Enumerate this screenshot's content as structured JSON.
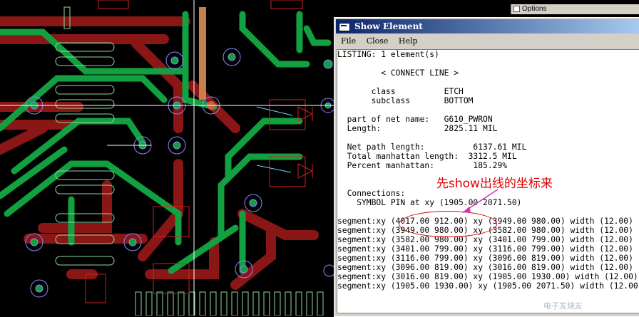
{
  "colors": {
    "green": "#13a040",
    "red": "#8b1616",
    "pad": "#8fd9a0",
    "via_ring": "#8888ff",
    "bg": "#000000",
    "annotation": "#e00000"
  },
  "options_bar": {
    "label": "Options"
  },
  "window": {
    "title": "Show Element",
    "menu": [
      "File",
      "Close",
      "Help"
    ],
    "listing": [
      "LISTING: 1 element(s)",
      "",
      "         < CONNECT LINE >",
      "",
      "       class          ETCH",
      "       subclass       BOTTOM",
      "",
      "  part of net name:   G610_PWRON",
      "  Length:             2825.11 MIL",
      "",
      "  Net path length:          6137.61 MIL",
      "  Total manhattan length:  3312.5 MIL",
      "  Percent manhattan:        185.29%",
      "",
      "",
      "  Connections:",
      "    SYMBOL PIN at xy (1905.00 2071.50)",
      "",
      "segment:xy (4017.00 912.00) xy (3949.00 980.00) width (12.00)",
      "segment:xy (3949.00 980.00) xy (3582.00 980.00) width (12.00)",
      "segment:xy (3582.00 980.00) xy (3401.00 799.00) width (12.00)",
      "segment:xy (3401.00 799.00) xy (3116.00 799.00) width (12.00)",
      "segment:xy (3116.00 799.00) xy (3096.00 819.00) width (12.00)",
      "segment:xy (3096.00 819.00) xy (3016.00 819.00) width (12.00)",
      "segment:xy (3016.00 819.00) xy (1905.00 1930.00) width (12.00)",
      "segment:xy (1905.00 1930.00) xy (1905.00 2071.50) width (12.00)"
    ]
  },
  "annotation": {
    "text": "先show出线的坐标来"
  },
  "watermark": "电子发烧友"
}
